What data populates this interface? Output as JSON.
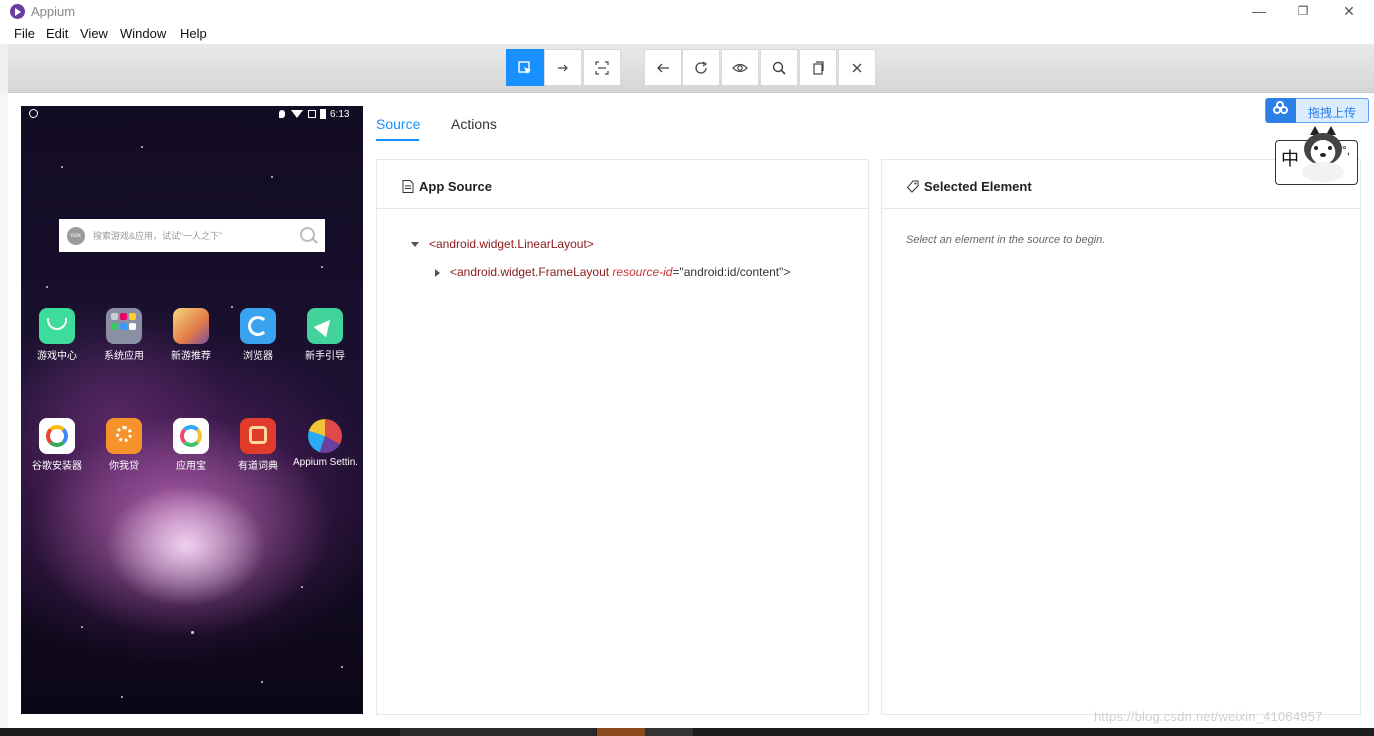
{
  "window": {
    "title": "Appium",
    "minimize_glyph": "—",
    "restore_glyph": "❐",
    "close_glyph": "✕"
  },
  "menu": [
    "File",
    "Edit",
    "View",
    "Window",
    "Help"
  ],
  "toolbar": {
    "buttons": [
      {
        "name": "select-elements",
        "icon": "select-arrow-icon",
        "active": true
      },
      {
        "name": "swipe-by-coordinates",
        "icon": "arrow-right-icon",
        "active": false
      },
      {
        "name": "tap-by-coordinates",
        "icon": "scan-icon",
        "active": false
      },
      {
        "name": "back",
        "icon": "back-arrow-icon",
        "active": false
      },
      {
        "name": "refresh",
        "icon": "refresh-icon",
        "active": false
      },
      {
        "name": "start-recording",
        "icon": "eye-icon",
        "active": false
      },
      {
        "name": "search-elements",
        "icon": "search-icon",
        "active": false
      },
      {
        "name": "copy-xml",
        "icon": "copy-icon",
        "active": false
      },
      {
        "name": "quit-session",
        "icon": "close-icon",
        "active": false
      }
    ],
    "accent": "#1890ff"
  },
  "device": {
    "status_time": "6:13",
    "search_placeholder": "搜索游戏&应用，试试“一人之下”",
    "search_logo_text": "nox",
    "apps_row1": [
      {
        "label": "游戏中心",
        "color": "#3ddc9a"
      },
      {
        "label": "系统应用",
        "color": "#8a8fa3"
      },
      {
        "label": "新游推荐",
        "color": "#e8b24a"
      },
      {
        "label": "浏览器",
        "color": "#3aa3f0"
      },
      {
        "label": "新手引导",
        "color": "#41d39b"
      }
    ],
    "apps_row2": [
      {
        "label": "谷歌安装器",
        "color": "#ffffff"
      },
      {
        "label": "你我贷",
        "color": "#f5922a"
      },
      {
        "label": "应用宝",
        "color": "#ffffff"
      },
      {
        "label": "有道词典",
        "color": "#e03b2b"
      },
      {
        "label": "Appium Settin..",
        "color": "#e24a4a"
      }
    ]
  },
  "tabs": [
    {
      "label": "Source",
      "active": true
    },
    {
      "label": "Actions",
      "active": false
    }
  ],
  "source_panel": {
    "title": "App Source",
    "tree": [
      {
        "tag": "<android.widget.LinearLayout>",
        "expanded": true
      },
      {
        "tag": "<android.widget.FrameLayout",
        "attr_name": "resource-id",
        "attr_value": "=\"android:id/content\">",
        "expanded": false
      }
    ]
  },
  "selected_panel": {
    "title": "Selected Element",
    "hint": "Select an element in the source to begin."
  },
  "overlay": {
    "upload_label": "拖拽上传",
    "ime_char": "中",
    "ime_extra": "°,"
  },
  "watermark": "https://blog.csdn.net/weixin_41064957"
}
